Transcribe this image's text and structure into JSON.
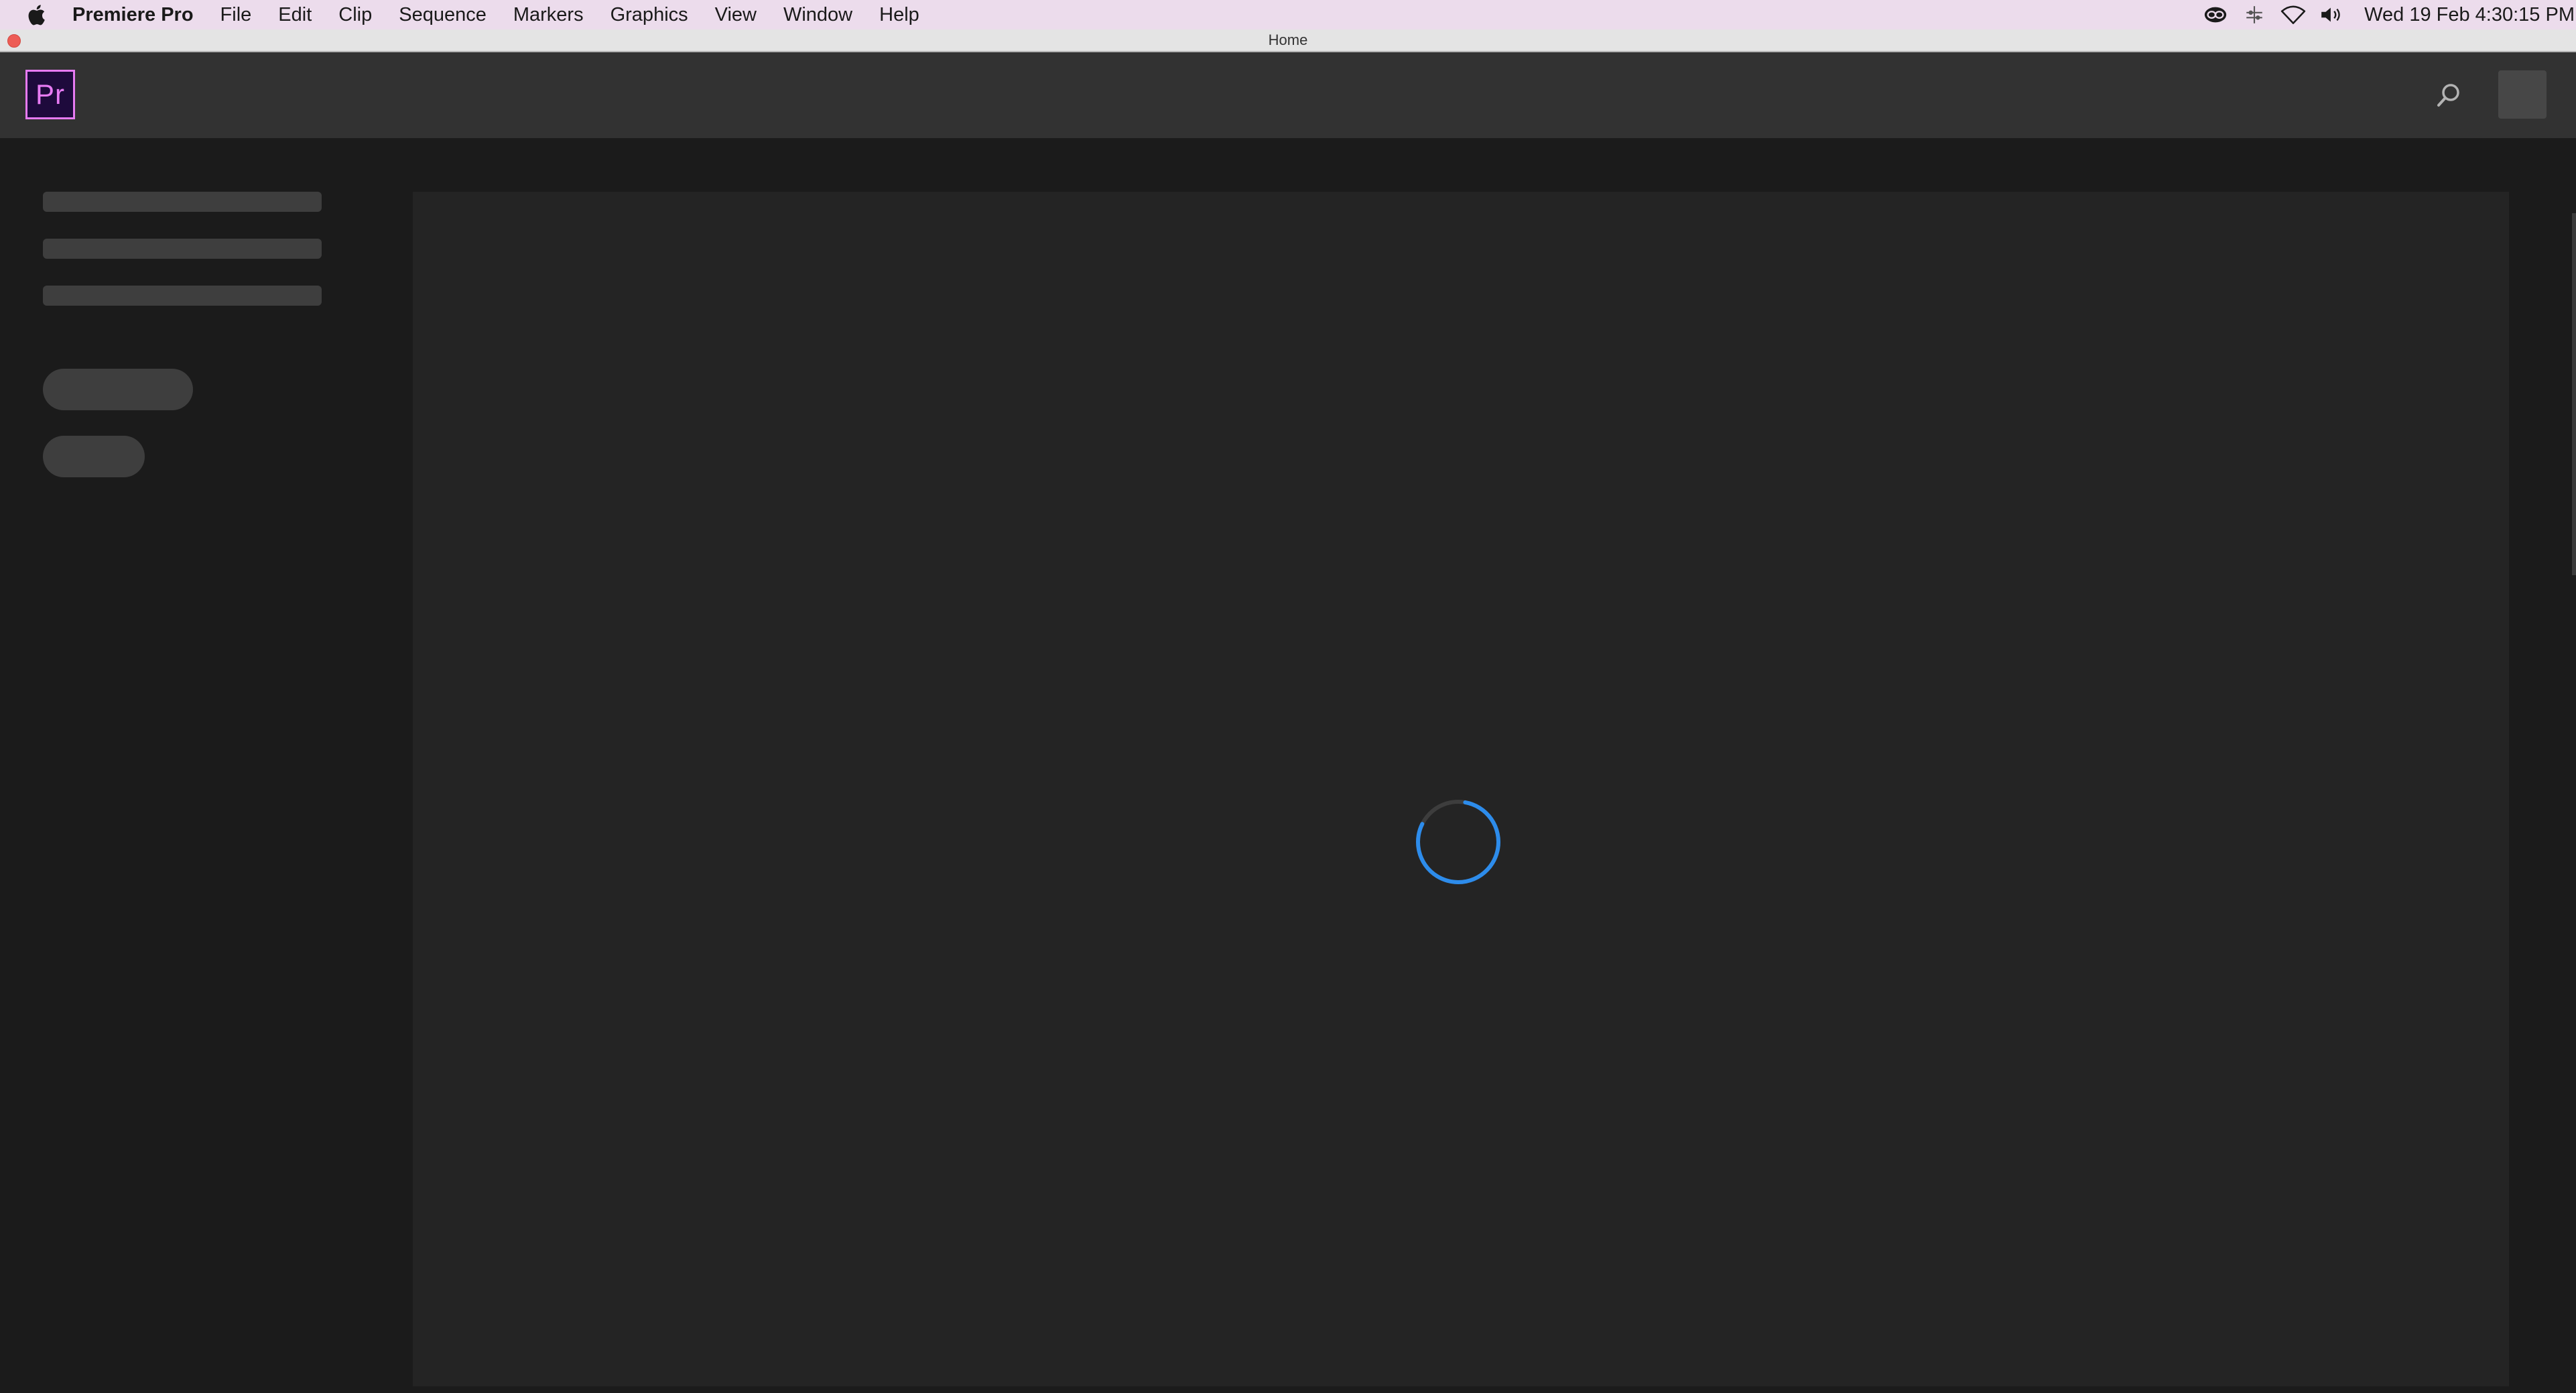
{
  "menubar": {
    "app_name": "Premiere Pro",
    "items": [
      "File",
      "Edit",
      "Clip",
      "Sequence",
      "Markers",
      "Graphics",
      "View",
      "Window",
      "Help"
    ],
    "clock": "Wed 19 Feb  4:30:15 PM"
  },
  "window": {
    "title": "Home"
  },
  "header": {
    "logo_text": "Pr",
    "logo_color": "#e77bf3",
    "logo_bg": "#1e0a3c"
  },
  "main": {
    "state": "loading",
    "spinner_color": "#2d8ceb"
  },
  "icons": {
    "apple": "apple-icon",
    "creative_cloud": "creative-cloud-icon",
    "control_center": "control-center-icon",
    "wifi": "wifi-icon",
    "volume": "volume-icon",
    "search": "search-icon",
    "spinner": "loading-spinner-icon"
  }
}
